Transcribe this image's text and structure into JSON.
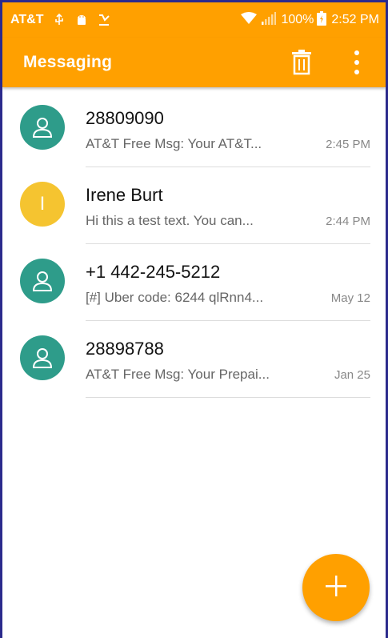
{
  "status_bar": {
    "carrier": "AT&T",
    "battery": "100%",
    "time": "2:52 PM",
    "icons": [
      "usb-icon",
      "android-icon",
      "missed-call-icon",
      "wifi-icon",
      "signal-icon",
      "battery-icon"
    ]
  },
  "app_bar": {
    "title": "Messaging",
    "actions": [
      "trash-icon",
      "more-vert-icon"
    ]
  },
  "conversations": [
    {
      "name": "28809090",
      "preview": "AT&T Free Msg: Your AT&T...",
      "time": "2:45 PM",
      "avatar": "person-icon",
      "avatar_color": "#2e9c8a"
    },
    {
      "name": "Irene Burt",
      "preview": "Hi this a test text.  You can...",
      "time": "2:44 PM",
      "avatar_letter": "I",
      "avatar_color": "#f5c430"
    },
    {
      "name": "+1 442-245-5212",
      "preview": "[#] Uber code: 6244 qlRnn4...",
      "time": "May 12",
      "avatar": "person-icon",
      "avatar_color": "#2e9c8a"
    },
    {
      "name": "28898788",
      "preview": "AT&T Free Msg: Your Prepai...",
      "time": "Jan 25",
      "avatar": "person-icon",
      "avatar_color": "#2e9c8a"
    }
  ],
  "fab": {
    "icon": "plus-icon"
  },
  "colors": {
    "accent": "#ffa000",
    "teal": "#2e9c8a",
    "yellow": "#f5c430"
  }
}
